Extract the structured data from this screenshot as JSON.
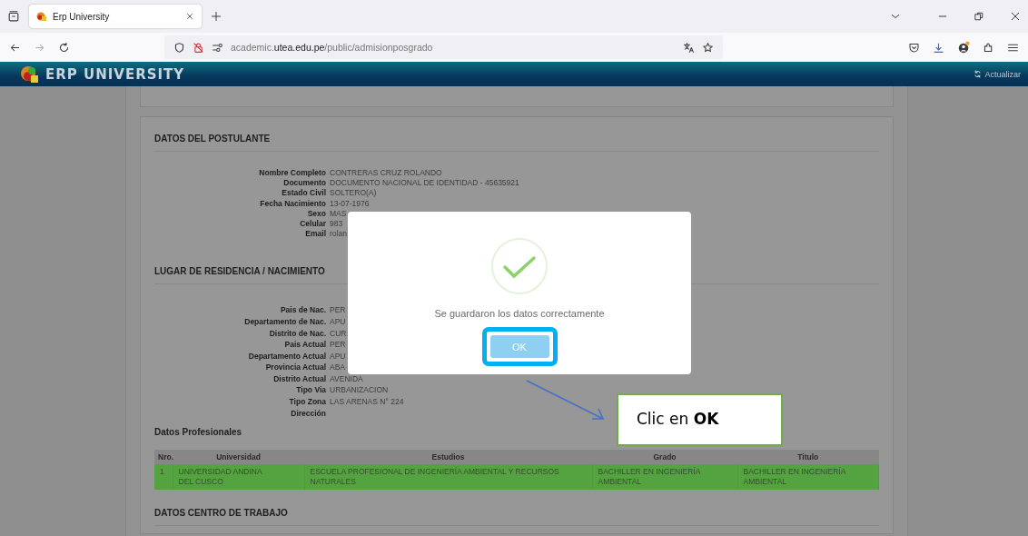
{
  "browser": {
    "tab_title": "Erp University",
    "url": "academic.**utea.edu.pe**/public/admisionposgrado"
  },
  "app_header": {
    "logo_text": "ERP UNIVERSITY",
    "refresh": "Actualizar"
  },
  "postulante": {
    "title": "DATOS DEL POSTULANTE",
    "fields": [
      {
        "label": "Nombre Completo",
        "value": "CONTRERAS CRUZ ROLANDO"
      },
      {
        "label": "Documento",
        "value": "DOCUMENTO NACIONAL DE IDENTIDAD - 45635921"
      },
      {
        "label": "Estado Civil",
        "value": "SOLTERO(A)"
      },
      {
        "label": "Fecha Nacimiento",
        "value": "13-07-1976"
      },
      {
        "label": "Sexo",
        "value": "MAS"
      },
      {
        "label": "Celular",
        "value": "983"
      },
      {
        "label": "Email",
        "value": "rolan"
      }
    ]
  },
  "residencia": {
    "title": "LUGAR DE RESIDENCIA / NACIMIENTO",
    "fields": [
      {
        "label": "Pais de Nac.",
        "value": "PER"
      },
      {
        "label": "Departamento de Nac.",
        "value": "APU"
      },
      {
        "label": "Distrito de Nac.",
        "value": "CUR"
      },
      {
        "label": "Pais Actual",
        "value": "PER"
      },
      {
        "label": "Departamento Actual",
        "value": "APU"
      },
      {
        "label": "Provincia Actual",
        "value": "ABA"
      },
      {
        "label": "Distrito Actual",
        "value": "AVENIDA"
      },
      {
        "label": "Tipo Via",
        "value": "URBANIZACION"
      },
      {
        "label": "Tipo Zona",
        "value": "LAS ARENAS N° 224"
      },
      {
        "label": "Dirección"
      }
    ]
  },
  "profesionales": {
    "title": "Datos Profesionales",
    "columns": [
      "Nro.",
      "Universidad",
      "Estudios",
      "Grado",
      "Titulo"
    ],
    "rows": [
      [
        "1",
        "UNIVERSIDAD ANDINA DEL CUSCO",
        "ESCUELA PROFESIONAL DE INGENIERÍA AMBIENTAL Y RECURSOS NATURALES",
        "BACHILLER EN INGENIERÍA AMBIENTAL",
        "BACHILLER EN INGENIERÍA AMBIENTAL"
      ]
    ]
  },
  "trabajo": {
    "title": "DATOS CENTRO DE TRABAJO"
  },
  "dialog": {
    "message": "Se guardaron los datos correctamente",
    "button": "OK"
  },
  "callout": {
    "text": "Clic en **OK**"
  }
}
